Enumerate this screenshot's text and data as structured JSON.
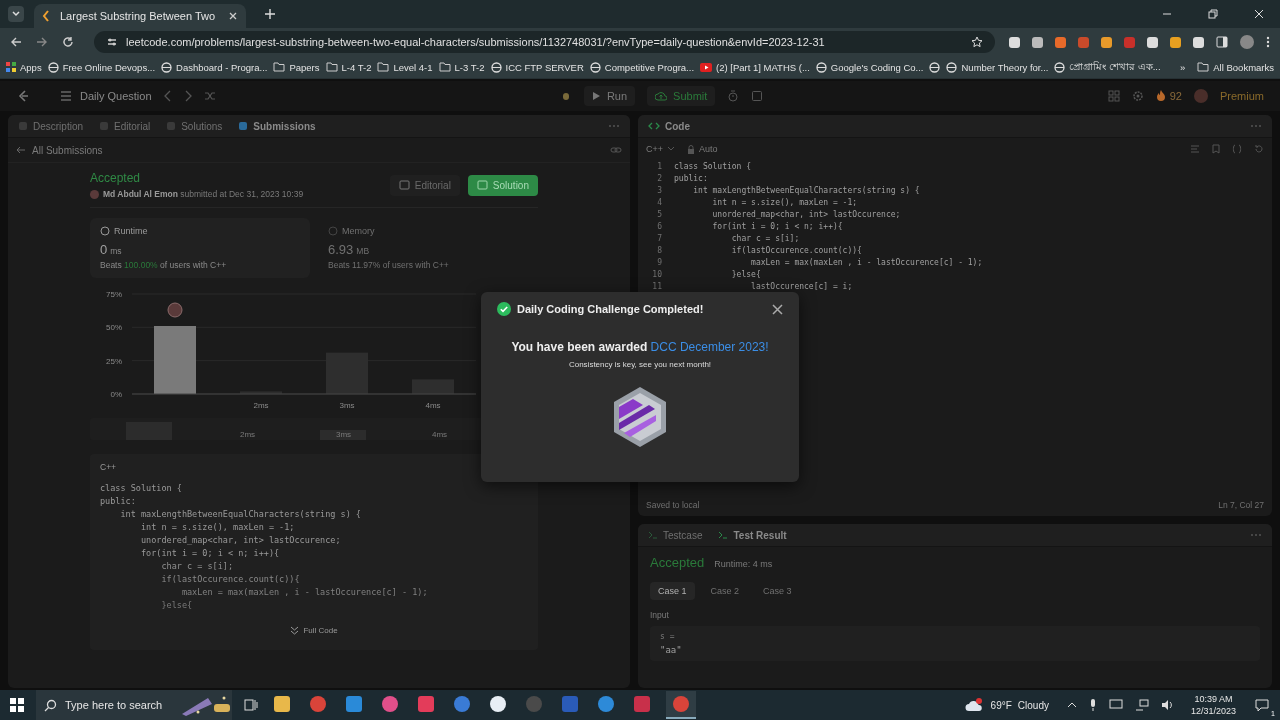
{
  "browser": {
    "tab_title": "Largest Substring Between Two",
    "url": "leetcode.com/problems/largest-substring-between-two-equal-characters/submissions/1132748031/?envType=daily-question&envId=2023-12-31",
    "bookmarks": [
      {
        "label": "Apps",
        "kind": "apps"
      },
      {
        "label": "Free Online Devops...",
        "kind": "site"
      },
      {
        "label": "Dashboard - Progra...",
        "kind": "site"
      },
      {
        "label": "Papers",
        "kind": "folder"
      },
      {
        "label": "L-4 T-2",
        "kind": "folder"
      },
      {
        "label": "Level 4-1",
        "kind": "folder"
      },
      {
        "label": "L-3 T-2",
        "kind": "folder"
      },
      {
        "label": "ICC FTP SERVER",
        "kind": "site"
      },
      {
        "label": "Competitive Progra...",
        "kind": "site"
      },
      {
        "label": "(2) [Part 1] MATHS (...",
        "kind": "video"
      },
      {
        "label": "Google's Coding Co...",
        "kind": "site"
      },
      {
        "kind": "icon"
      },
      {
        "label": "Number Theory for...",
        "kind": "site"
      },
      {
        "label": "প্রোগ্রামিং শেখার এক...",
        "kind": "site"
      }
    ],
    "overflow": "»",
    "all_bookmarks": "All Bookmarks"
  },
  "header": {
    "title": "Daily Question",
    "run": "Run",
    "submit": "Submit",
    "streak": "92",
    "premium": "Premium"
  },
  "left": {
    "tabs": [
      {
        "label": "Description",
        "selected": false
      },
      {
        "label": "Editorial",
        "selected": false
      },
      {
        "label": "Solutions",
        "selected": false
      },
      {
        "label": "Submissions",
        "selected": true
      }
    ],
    "back": "All Submissions",
    "status": "Accepted",
    "author": "Md Abdul Al Emon",
    "submitted": "submitted at Dec 31, 2023 10:39",
    "buttons": [
      {
        "label": "Editorial",
        "kind": "plain"
      },
      {
        "label": "Solution",
        "kind": "primary"
      }
    ],
    "metrics": [
      {
        "title": "Runtime",
        "value": "0",
        "unit": "ms",
        "beats_label": "Beats",
        "beats": "100.00%",
        "suffix": "of users with C++",
        "selected": true
      },
      {
        "title": "Memory",
        "value": "6.93",
        "unit": "MB",
        "beats_label": "Beats",
        "beats": "11.97%",
        "suffix": "of users with C++",
        "selected": false
      }
    ],
    "chart_data": {
      "type": "bar",
      "x": [
        1,
        2,
        3,
        4
      ],
      "values": [
        51,
        2,
        31,
        11
      ],
      "xlim": [
        0.5,
        4.5
      ],
      "ylim": [
        0,
        75
      ],
      "yticks": [
        {
          "value": 0,
          "label": "0%"
        },
        {
          "value": 25,
          "label": "25%"
        },
        {
          "value": 50,
          "label": "50%"
        },
        {
          "value": 75,
          "label": "75%"
        }
      ],
      "xticks": [
        {
          "value": 2,
          "label": "2ms"
        },
        {
          "value": 3,
          "label": "3ms"
        },
        {
          "value": 4,
          "label": "4ms"
        }
      ]
    },
    "overview_labels": [
      "2ms",
      "3ms",
      "4ms"
    ],
    "solution_code": {
      "language": "C++",
      "lines": [
        "class Solution {",
        "public:",
        "    int maxLengthBetweenEqualCharacters(string s) {",
        "        int n = s.size(), maxLen = -1;",
        "        unordered_map<char, int> lastOccurence;",
        "        for(int i = 0; i < n; i++){",
        "            char c = s[i];",
        "            if(lastOccurence.count(c)){",
        "                maxLen = max(maxLen , i - lastOccurence[c] - 1);",
        "            }else{"
      ],
      "expand": "Full Code"
    }
  },
  "editor": {
    "title": "Code",
    "language": "C++",
    "mode": "Auto",
    "lines": [
      {
        "n": "1",
        "text": "class Solution {"
      },
      {
        "n": "2",
        "text": "public:"
      },
      {
        "n": "3",
        "text": "    int maxLengthBetweenEqualCharacters(string s) {"
      },
      {
        "n": "4",
        "text": "        int n = s.size(), maxLen = -1;"
      },
      {
        "n": "5",
        "text": "        unordered_map<char, int> lastOccurence;"
      },
      {
        "n": "6",
        "text": "        for(int i = 0; i < n; i++){"
      },
      {
        "n": "7",
        "text": "            char c = s[i];"
      },
      {
        "n": "8",
        "text": "            if(lastOccurence.count(c)){"
      },
      {
        "n": "9",
        "text": "                maxLen = max(maxLen , i - lastOccurence[c] - 1);"
      },
      {
        "n": "10",
        "text": "            }else{"
      },
      {
        "n": "11",
        "text": "                lastOccurence[c] = i;"
      }
    ],
    "status": "Saved to local",
    "cursor": "Ln 7, Col 27"
  },
  "test": {
    "tabs": [
      {
        "label": "Testcase",
        "selected": false
      },
      {
        "label": "Test Result",
        "selected": true
      }
    ],
    "status": "Accepted",
    "runtime": "Runtime: 4 ms",
    "cases": [
      {
        "label": "Case 1",
        "selected": true
      },
      {
        "label": "Case 2",
        "selected": false
      },
      {
        "label": "Case 3",
        "selected": false
      }
    ],
    "input_label": "Input",
    "param": "s =",
    "value": "\"aa\""
  },
  "modal": {
    "title": "Daily Coding Challenge Completed!",
    "message": "You have been awarded",
    "award": "DCC December 2023!",
    "subtitle": "Consistency is key, see you next month!"
  },
  "taskbar": {
    "search_placeholder": "Type here to search",
    "temperature": "69°F",
    "condition": "Cloudy",
    "time": "10:39 AM",
    "date": "12/31/2023",
    "notifications": "1"
  }
}
